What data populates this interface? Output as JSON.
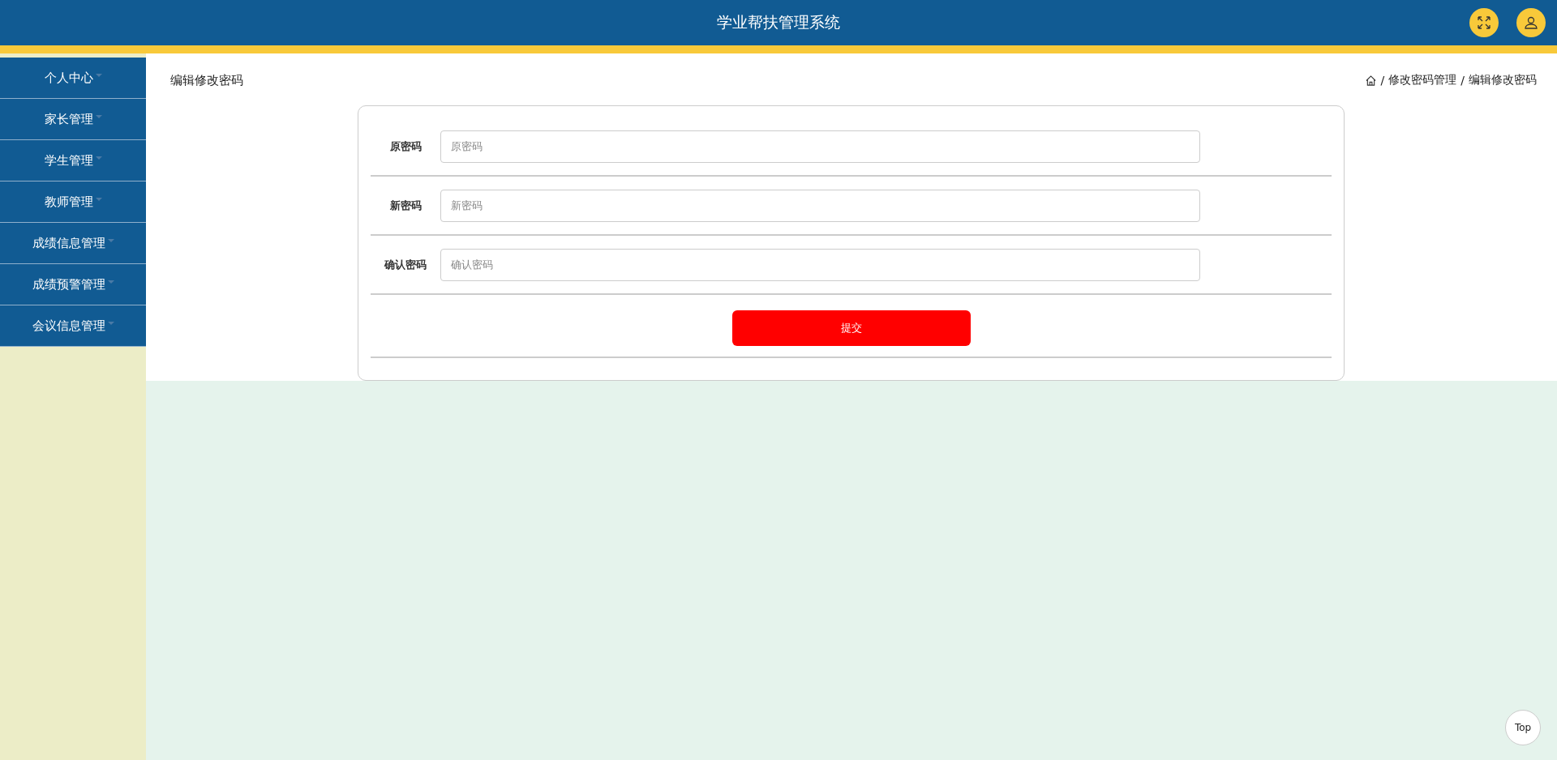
{
  "header": {
    "title": "学业帮扶管理系统"
  },
  "sidebar": {
    "items": [
      {
        "label": "个人中心"
      },
      {
        "label": "家长管理"
      },
      {
        "label": "学生管理"
      },
      {
        "label": "教师管理"
      },
      {
        "label": "成绩信息管理"
      },
      {
        "label": "成绩预警管理"
      },
      {
        "label": "会议信息管理"
      }
    ]
  },
  "page_title": "编辑修改密码",
  "breadcrumb": {
    "separator": "/",
    "items": [
      "修改密码管理",
      "编辑修改密码"
    ]
  },
  "form": {
    "fields": [
      {
        "label": "原密码",
        "placeholder": "原密码"
      },
      {
        "label": "新密码",
        "placeholder": "新密码"
      },
      {
        "label": "确认密码",
        "placeholder": "确认密码"
      }
    ],
    "submit": "提交"
  },
  "back_to_top": "Top"
}
